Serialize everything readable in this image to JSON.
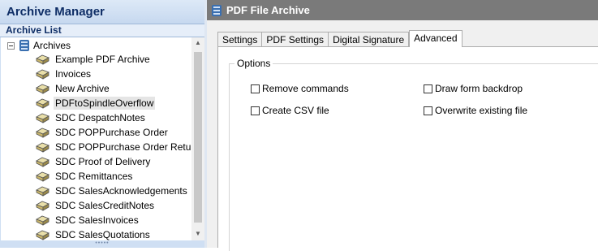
{
  "sidebar": {
    "app_title": "Archive Manager",
    "list_header": "Archive List",
    "root_label": "Archives",
    "items": [
      {
        "label": "Example PDF Archive",
        "selected": false
      },
      {
        "label": "Invoices",
        "selected": false
      },
      {
        "label": "New Archive",
        "selected": false
      },
      {
        "label": "PDFtoSpindleOverflow",
        "selected": true
      },
      {
        "label": "SDC DespatchNotes",
        "selected": false
      },
      {
        "label": "SDC POPPurchase Order",
        "selected": false
      },
      {
        "label": "SDC POPPurchase Order Return",
        "selected": false
      },
      {
        "label": "SDC Proof of Delivery",
        "selected": false
      },
      {
        "label": "SDC Remittances",
        "selected": false
      },
      {
        "label": "SDC SalesAcknowledgements",
        "selected": false
      },
      {
        "label": "SDC SalesCreditNotes",
        "selected": false
      },
      {
        "label": "SDC SalesInvoices",
        "selected": false
      },
      {
        "label": "SDC SalesQuotations",
        "selected": false
      }
    ]
  },
  "main": {
    "header_title": "PDF File Archive",
    "tabs": [
      {
        "label": "Settings",
        "active": false
      },
      {
        "label": "PDF Settings",
        "active": false
      },
      {
        "label": "Digital Signature",
        "active": false
      },
      {
        "label": "Advanced",
        "active": true
      }
    ],
    "options_group_label": "Options",
    "options": {
      "remove_commands": {
        "label": "Remove commands",
        "checked": false
      },
      "create_csv": {
        "label": "Create CSV file",
        "checked": false
      },
      "draw_form_backdrop": {
        "label": "Draw form backdrop",
        "checked": false
      },
      "overwrite_existing": {
        "label": "Overwrite existing file",
        "checked": false
      }
    }
  },
  "icons": {
    "root": "database-icon",
    "archive_item": "archive-box-icon",
    "header": "database-icon"
  },
  "colors": {
    "sidebar_bg": "#cfdff3",
    "title_text": "#0f2e66",
    "doc_header_bg": "#7a7a7a"
  }
}
